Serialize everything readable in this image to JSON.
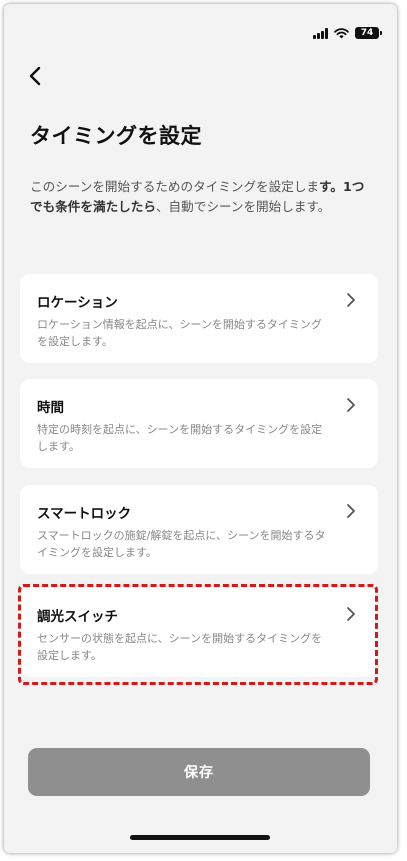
{
  "status_bar": {
    "battery": "74"
  },
  "header": {
    "title": "タイミングを設定"
  },
  "description": {
    "intro": "このシーンを開始するためのタイミングを設定しま",
    "intro_end": "す。",
    "emphasis": "1つでも条件を満たしたら",
    "rest": "、自動でシーンを開始します。"
  },
  "options": [
    {
      "title": "ロケーション",
      "description": "ロケーション情報を起点に、シーンを開始するタイミングを設定します。"
    },
    {
      "title": "時間",
      "description": "特定の時刻を起点に、シーンを開始するタイミングを設定します。"
    },
    {
      "title": "スマートロック",
      "description": "スマートロックの施錠/解錠を起点に、シーンを開始するタイミングを設定します。"
    },
    {
      "title": "調光スイッチ",
      "description": "センサーの状態を起点に、シーンを開始するタイミングを設定します。"
    }
  ],
  "footer": {
    "save_label": "保存"
  },
  "colors": {
    "background": "#f3f3f3",
    "card": "#ffffff",
    "highlight": "#d21a1a",
    "button_disabled": "#8f8f8f"
  }
}
